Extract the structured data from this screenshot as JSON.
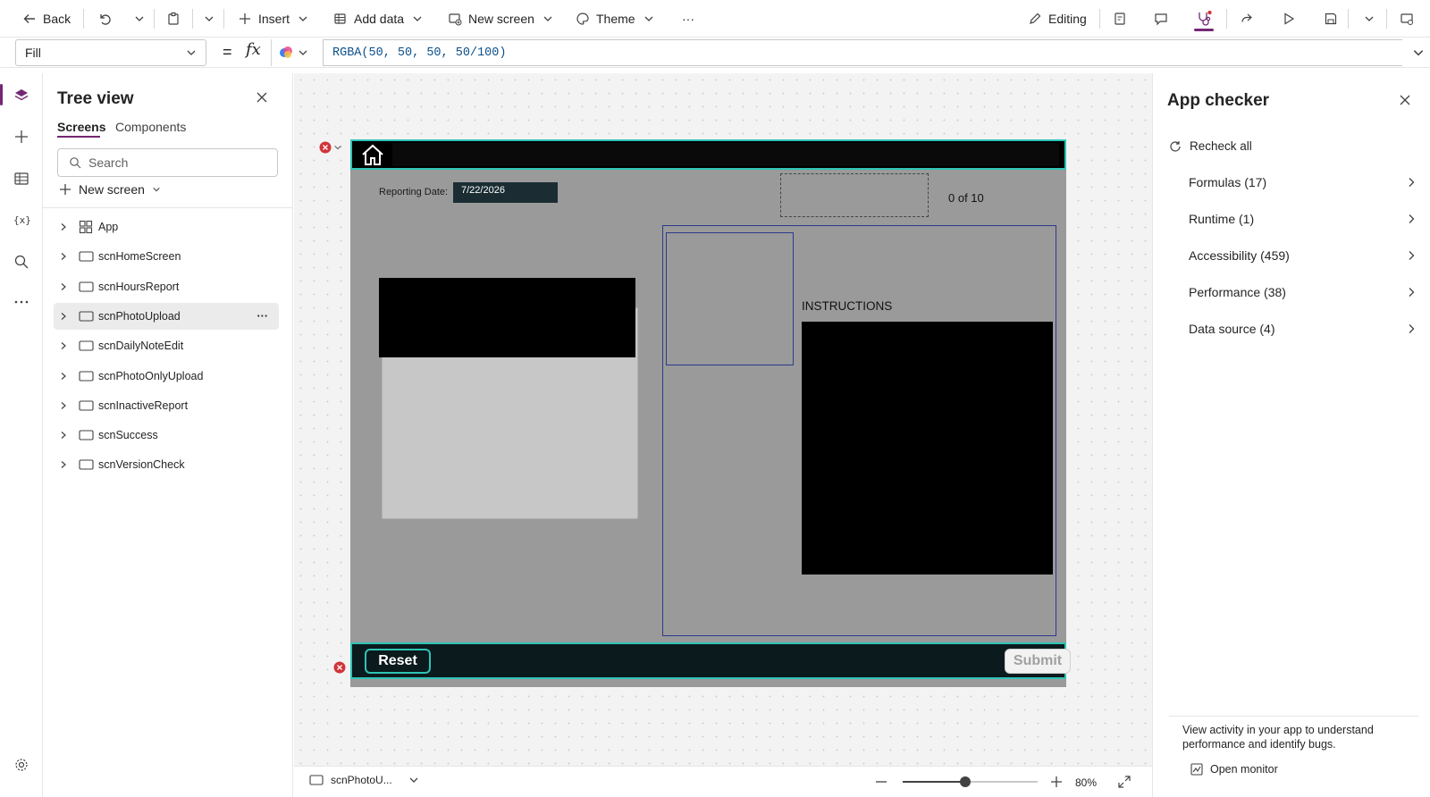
{
  "toolbar": {
    "back": "Back",
    "insert": "Insert",
    "add_data": "Add data",
    "new_screen": "New screen",
    "theme": "Theme",
    "more": "···",
    "editing": "Editing"
  },
  "formula_bar": {
    "property": "Fill",
    "equals": "=",
    "fx": "fx",
    "formula": "RGBA(50, 50, 50, 50/100)"
  },
  "tree_view": {
    "title": "Tree view",
    "tabs": [
      "Screens",
      "Components"
    ],
    "search_placeholder": "Search",
    "new_screen": "New screen",
    "nodes": [
      "App",
      "scnHomeScreen",
      "scnHoursReport",
      "scnPhotoUpload",
      "scnDailyNoteEdit",
      "scnPhotoOnlyUpload",
      "scnInactiveReport",
      "scnSuccess",
      "scnVersionCheck"
    ],
    "selected_index": 3,
    "more": "···"
  },
  "app_screen": {
    "reporting_label": "Reporting Date:",
    "reporting_date": "7/22/2026",
    "counter": "0 of 10",
    "instructions": "INSTRUCTIONS",
    "reset": "Reset",
    "submit": "Submit"
  },
  "status_bar": {
    "screen_name": "scnPhotoU...",
    "zoom": "80%",
    "zoom_level_percent": 80
  },
  "app_checker": {
    "title": "App checker",
    "recheck": "Recheck all",
    "categories": [
      "Formulas (17)",
      "Runtime (1)",
      "Accessibility (459)",
      "Performance (38)",
      "Data source (4)"
    ],
    "footer_text": "View activity in your app to understand performance and identify bugs.",
    "open_monitor": "Open monitor"
  },
  "colors": {
    "accent": "#742774",
    "app_bg": "#9a9a9a",
    "header_border": "#2ec4b6",
    "error": "#d13438",
    "date_field_bg": "#1b2d33"
  }
}
